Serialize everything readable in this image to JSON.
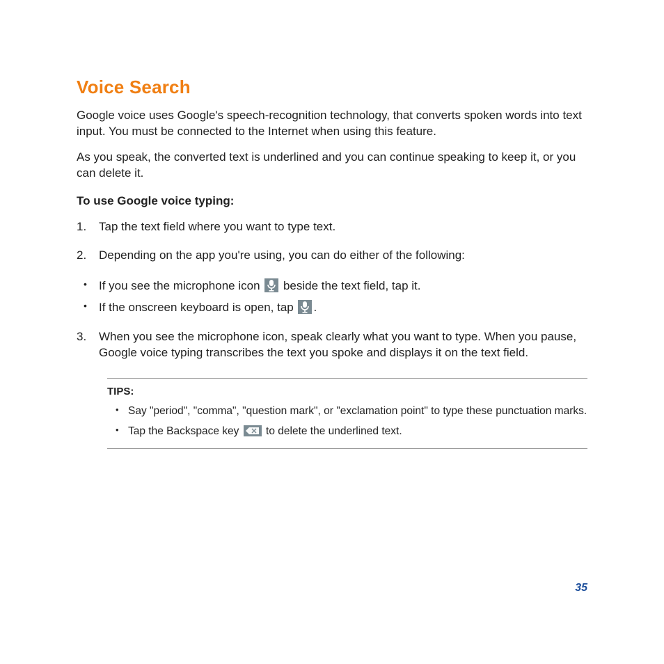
{
  "title": "Voice Search",
  "intro1": "Google voice uses Google's speech-recognition technology, that converts spoken words into text input. You must be connected to the Internet when using this feature.",
  "intro2": "As you speak, the converted text is underlined and you can continue speaking to keep it, or you can delete it.",
  "subhead": "To use Google voice typing:",
  "step1": "Tap the text field where you want to type text.",
  "step2": "Depending on the app you're using, you can do either of the following:",
  "bullet1a": "If you see the microphone icon ",
  "bullet1b": " beside the text field, tap it.",
  "bullet2a": "If the onscreen keyboard is open, tap ",
  "bullet2b": ".",
  "step3": "When you see the microphone icon, speak clearly what you want to type. When you pause, Google voice typing transcribes the text you spoke and displays it on the text field.",
  "tips_head": "TIPS:",
  "tip1": "Say \"period\", \"comma\", \"question mark\", or \"exclamation point\" to type these punctuation marks.",
  "tip2a": "Tap the Backspace key ",
  "tip2b": " to delete the underlined text.",
  "page_number": "35"
}
